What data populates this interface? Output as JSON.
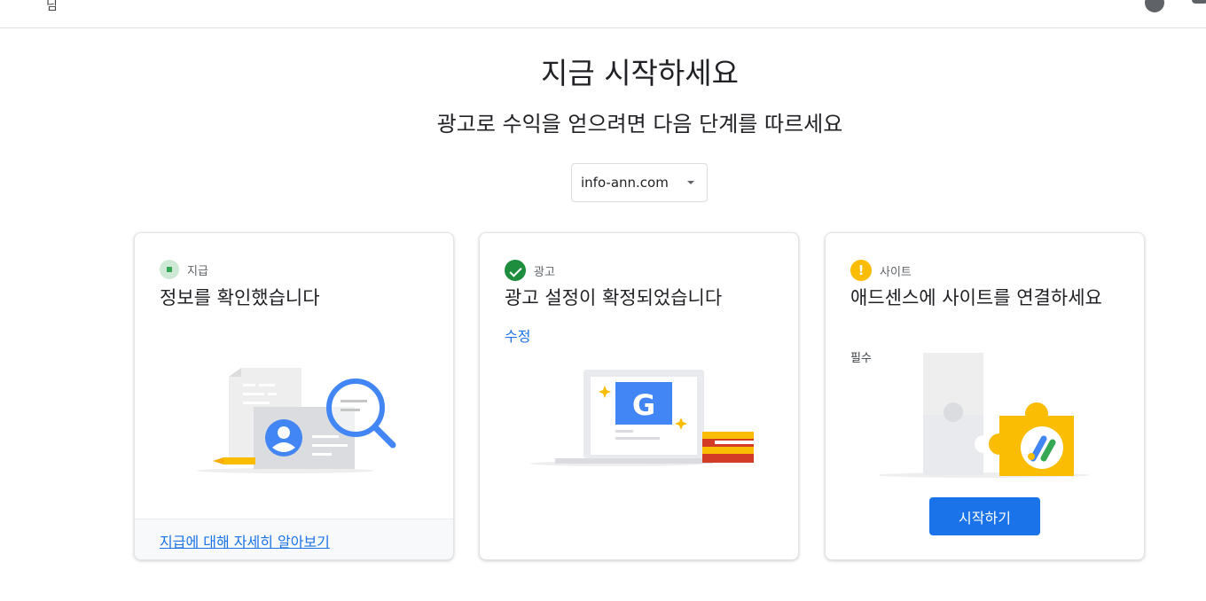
{
  "header": {
    "left_glyph": "님"
  },
  "page": {
    "title": "지금 시작하세요",
    "subtitle": "광고로 수익을 얻으려면 다음 단계를 따르세요"
  },
  "site_selector": {
    "value": "info-ann.com"
  },
  "cards": [
    {
      "status_label": "지급",
      "heading": "정보를 확인했습니다",
      "footer_link": "지급에 대해 자세히 알아보기",
      "status_icon": "in-progress-icon"
    },
    {
      "status_label": "광고",
      "heading": "광고 설정이 확정되었습니다",
      "edit_link": "수정",
      "status_icon": "check-circle-icon"
    },
    {
      "status_label": "사이트",
      "heading": "애드센스에 사이트를 연결하세요",
      "required_text": "필수",
      "button_label": "시작하기",
      "status_icon": "warning-circle-icon"
    }
  ],
  "colors": {
    "accent": "#1a73e8",
    "success": "#1e8e3e",
    "warning": "#fbbc04",
    "google_blue": "#4285f4"
  }
}
